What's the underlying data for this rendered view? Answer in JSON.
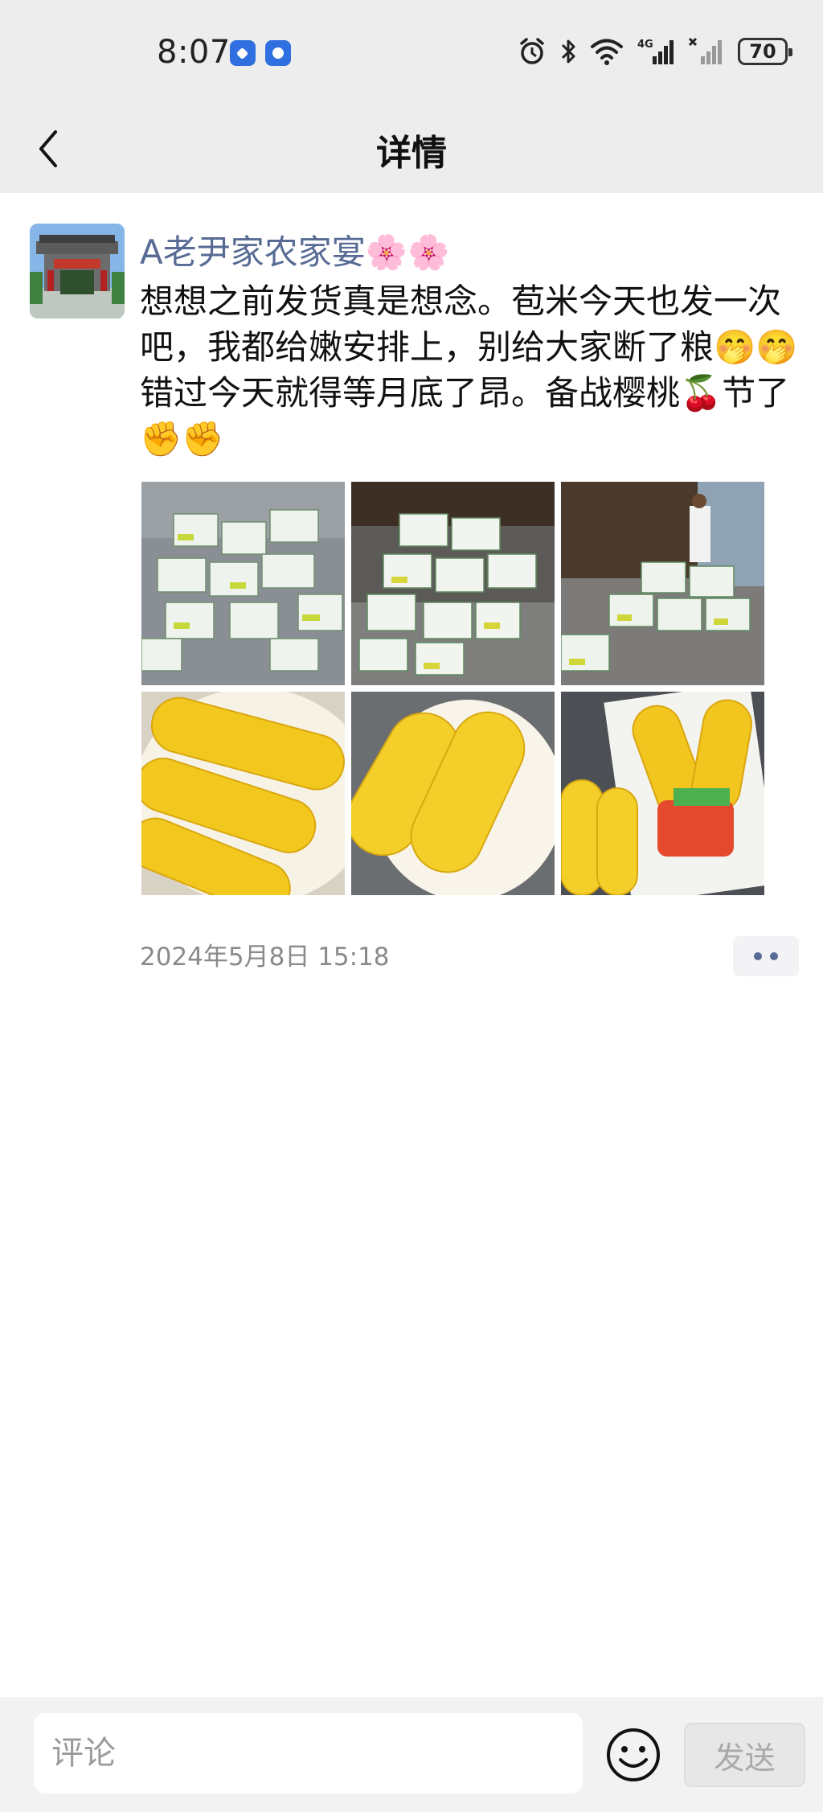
{
  "status_bar": {
    "time": "8:07",
    "battery": "70",
    "icons": [
      "alarm-icon",
      "bluetooth-icon",
      "wifi-icon",
      "signal-4g-icon",
      "signal-no-sim-icon",
      "battery-icon"
    ]
  },
  "header": {
    "title": "详情",
    "back_icon": "chevron-left-icon"
  },
  "post": {
    "author": "A老尹家农家宴🌸🌸",
    "content": "想想之前发货真是想念。苞米今天也发一次吧，我都给嫩安排上，别给大家断了粮🤭🤭错过今天就得等月底了昂。备战樱桃🍒节了✊✊",
    "photos": [
      "corn-boxes-photo-1",
      "corn-boxes-photo-2",
      "corn-boxes-photo-3",
      "cooked-corn-photo-1",
      "cooked-corn-photo-2",
      "packaged-corn-photo"
    ],
    "timestamp": "2024年5月8日 15:18"
  },
  "comment_bar": {
    "placeholder": "评论",
    "value": "",
    "send_label": "发送"
  },
  "colors": {
    "author_blue": "#576b95",
    "top_bar_bg": "#ededed"
  }
}
